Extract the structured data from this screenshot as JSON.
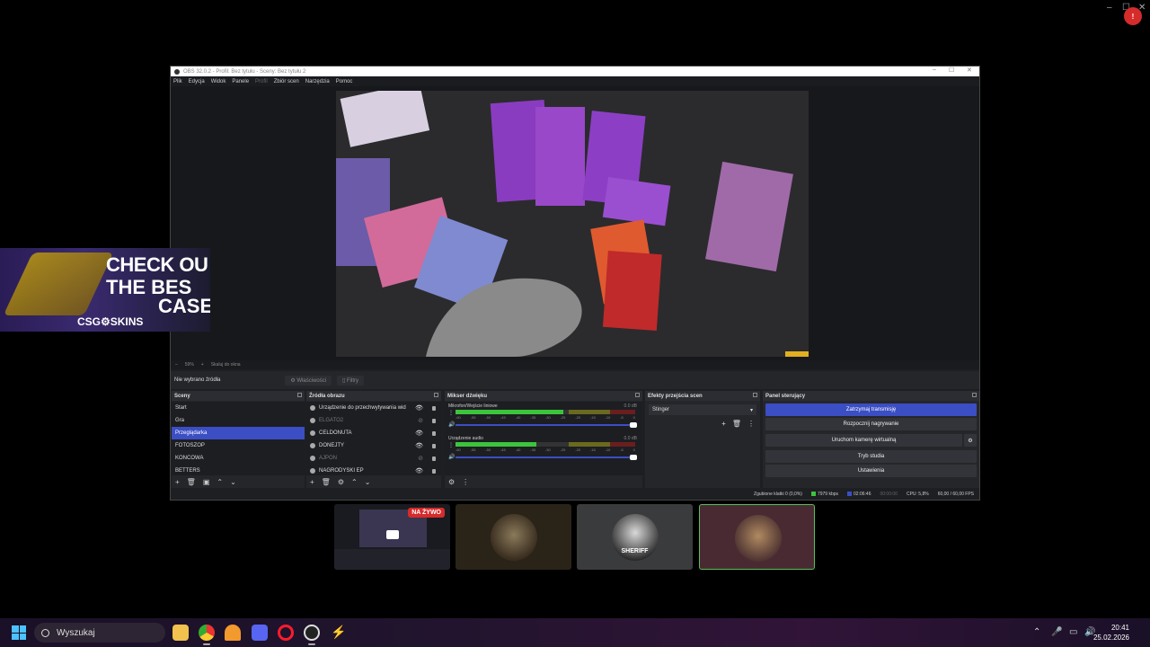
{
  "obs": {
    "title": "OBS 32.0.2 - Profil: Bez tytułu - Sceny: Bez tytułu 2",
    "menu": [
      "Plik",
      "Edycja",
      "Widok",
      "Panele",
      "Profil",
      "Zbiór scen",
      "Narzędzia",
      "Pomoc"
    ],
    "zoom": "59%",
    "fit": "Skaluj do okna",
    "no_source": "Nie wybrano źródła",
    "properties_label": "Właściwości",
    "filters_label": "Filtry",
    "docks": {
      "scenes": {
        "title": "Sceny",
        "items": [
          "Start",
          "Gra",
          "Przeglądarka",
          "FOTOSZOP",
          "KONCOWA",
          "BETTERS"
        ],
        "active": "Przeglądarka"
      },
      "sources": {
        "title": "Źródła obrazu",
        "items": [
          {
            "label": "Urządzenie do przechwytywania wid",
            "dim": false
          },
          {
            "label": "ELGATO2",
            "dim": true
          },
          {
            "label": "CELDONUTA",
            "dim": false
          },
          {
            "label": "DONEJTY",
            "dim": false
          },
          {
            "label": "AJPON",
            "dim": true
          },
          {
            "label": "NAGRODYSKI EP",
            "dim": false
          }
        ]
      },
      "mixer": {
        "title": "Mikser dźwięku",
        "channels": [
          {
            "name": "Mikrofon/Wejście liniowe",
            "db": "0.0 dB",
            "level": 0.6
          },
          {
            "name": "Urządzenie audio",
            "db": "0.0 dB",
            "level": 0.45
          }
        ],
        "ticks": [
          "-60",
          "-55",
          "-50",
          "-45",
          "-40",
          "-35",
          "-30",
          "-25",
          "-20",
          "-15",
          "-10",
          "-5",
          "0"
        ]
      },
      "transitions": {
        "title": "Efekty przejścia scen",
        "selected": "Stinger"
      },
      "controls": {
        "title": "Panel sterujący",
        "buttons": [
          "Zatrzymaj transmisję",
          "Rozpocznij nagrywanie",
          "Uruchom kamerę wirtualną",
          "Tryb studia",
          "Ustawienia"
        ]
      }
    },
    "status": {
      "dropped": "Zgubione klatki 0 (0,0%)",
      "kbps": "7979 kbps",
      "stream_time": "02:06:46",
      "rec_time": "00:00:00",
      "cpu": "CPU: 5,8%",
      "fps": "60,00 / 60,00 FPS"
    }
  },
  "ad": {
    "line1": "CHECK OU",
    "line2": "THE BES",
    "line3": "CASE",
    "brand": "CSG⚙SKINS"
  },
  "tiles": {
    "live_badge": "NA ŻYWO",
    "sheriff": "SHERIFF"
  },
  "taskbar": {
    "search_placeholder": "Wyszukaj",
    "time": "20:41",
    "date": "25.02.2026"
  },
  "colors": {
    "accent": "#3b4ec4",
    "live": "#d62b2b",
    "meter_green": "#3cc43c"
  }
}
